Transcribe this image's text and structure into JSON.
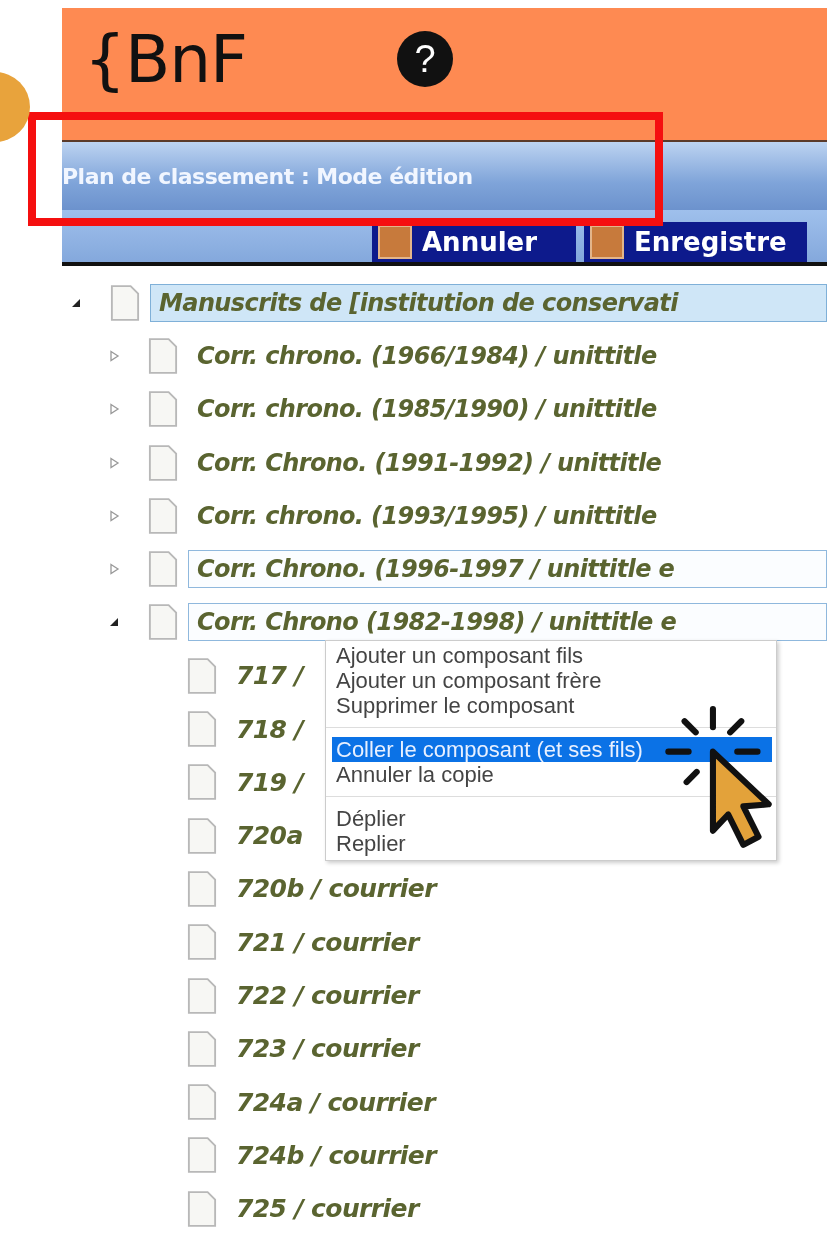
{
  "header": {
    "logo": "{BnF",
    "help": "?"
  },
  "title_bar": {
    "title": "Plan de classement : Mode édition"
  },
  "toolbar": {
    "buttons": [
      {
        "label": "Annuler"
      },
      {
        "label": "Enregistre"
      }
    ]
  },
  "tree": {
    "label": "Manuscrits de [institution de conservati",
    "expanded": true,
    "selected": true,
    "outlined": false,
    "children": [
      {
        "label": "Corr. chrono. (1966/1984) / unittitle",
        "expanded": false,
        "selected": false,
        "outlined": false
      },
      {
        "label": "Corr. chrono. (1985/1990) / unittitle",
        "expanded": false,
        "selected": false,
        "outlined": false
      },
      {
        "label": "Corr. Chrono. (1991-1992) / unittitle",
        "expanded": false,
        "selected": false,
        "outlined": false
      },
      {
        "label": "Corr. chrono. (1993/1995) / unittitle",
        "expanded": false,
        "selected": false,
        "outlined": false
      },
      {
        "label": "Corr. Chrono. (1996-1997 / unittitle e",
        "expanded": false,
        "selected": false,
        "outlined": true
      },
      {
        "label": "Corr. Chrono (1982-1998) / unittitle e",
        "expanded": true,
        "selected": false,
        "outlined": true,
        "children": [
          {
            "label": "717 /"
          },
          {
            "label": "718 /"
          },
          {
            "label": "719 /"
          },
          {
            "label": "720a"
          },
          {
            "label": "720b / courrier"
          },
          {
            "label": "721 / courrier"
          },
          {
            "label": "722 / courrier"
          },
          {
            "label": "723 / courrier"
          },
          {
            "label": "724a / courrier"
          },
          {
            "label": "724b / courrier"
          },
          {
            "label": "725 / courrier"
          }
        ]
      }
    ]
  },
  "context_menu": {
    "items": [
      {
        "kind": "item",
        "label": "Ajouter un composant fils",
        "selected": false
      },
      {
        "kind": "item",
        "label": "Ajouter un composant frère",
        "selected": false
      },
      {
        "kind": "item",
        "label": "Supprimer le composant",
        "selected": false
      },
      {
        "kind": "separator"
      },
      {
        "kind": "item",
        "label": "Coller le composant (et ses fils)",
        "selected": true
      },
      {
        "kind": "item",
        "label": "Annuler la copie",
        "selected": false
      },
      {
        "kind": "separator"
      },
      {
        "kind": "item",
        "label": "Déplier",
        "selected": false
      },
      {
        "kind": "item",
        "label": "Replier",
        "selected": false
      }
    ]
  }
}
